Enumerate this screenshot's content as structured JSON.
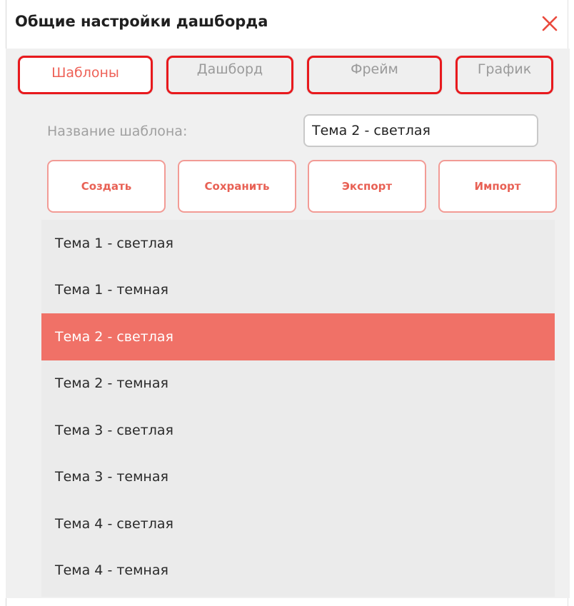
{
  "dialog": {
    "title": "Общие настройки дашборда",
    "close_icon": "close-icon"
  },
  "tabs": [
    {
      "label": "Шаблоны",
      "active": true
    },
    {
      "label": "Дашборд",
      "active": false
    },
    {
      "label": "Фрейм",
      "active": false
    },
    {
      "label": "График",
      "active": false
    }
  ],
  "template_form": {
    "name_label": "Название шаблона:",
    "name_value": "Тема 2 - светлая"
  },
  "actions": {
    "create": "Создать",
    "save": "Сохранить",
    "export": "Экспорт",
    "import": "Импорт"
  },
  "templates": {
    "selected_index": 2,
    "items": [
      "Тема 1 - светлая",
      "Тема 1 - темная",
      "Тема 2 - светлая",
      "Тема 2 - темная",
      "Тема 3 - светлая",
      "Тема 3 - темная",
      "Тема 4 - светлая",
      "Тема 4 - темная"
    ]
  },
  "colors": {
    "accent": "#e8191d",
    "selection": "#f07167",
    "button_text": "#e86155"
  }
}
